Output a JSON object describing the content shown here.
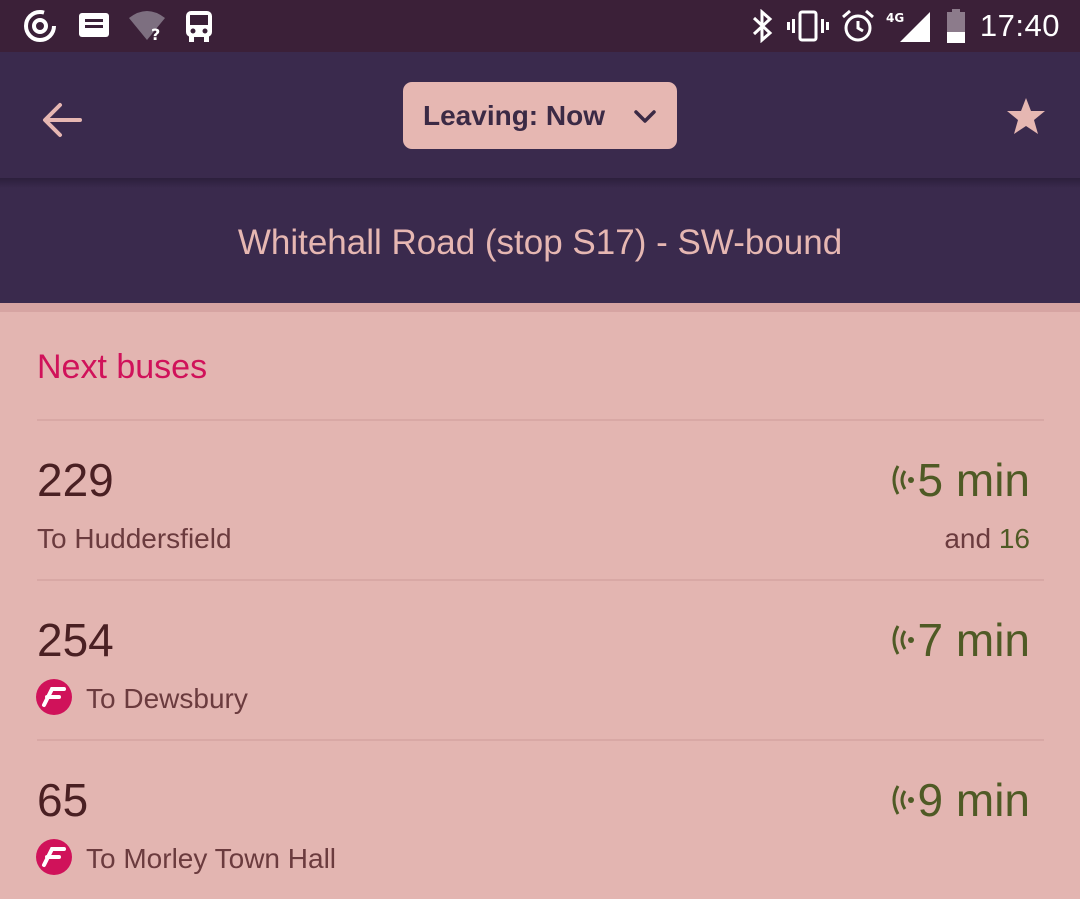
{
  "status_bar": {
    "time": "17:40",
    "network_label": "4G",
    "left_icons": [
      "signal-app-icon",
      "message-icon",
      "wifi-unknown-icon",
      "bus-app-icon"
    ],
    "right_icons": [
      "bluetooth-icon",
      "vibrate-icon",
      "alarm-icon",
      "cell-signal-icon",
      "battery-icon"
    ]
  },
  "toolbar": {
    "leaving_label": "Leaving: Now"
  },
  "stop": {
    "title": "Whitehall Road (stop S17) - SW-bound"
  },
  "section": {
    "title": "Next buses"
  },
  "departures": [
    {
      "route": "229",
      "destination": "To Huddersfield",
      "eta": "5 min",
      "and_label": "and",
      "next": "16",
      "has_operator_logo": false
    },
    {
      "route": "254",
      "destination": "To Dewsbury",
      "eta": "7 min",
      "has_operator_logo": true
    },
    {
      "route": "65",
      "destination": "To Morley Town Hall",
      "eta": "9 min",
      "has_operator_logo": true
    }
  ],
  "colors": {
    "status_bar": "#3b2038",
    "app_bar": "#3a2a4d",
    "background": "#e3b5b1",
    "accent": "#d0125a",
    "eta": "#4f5a25"
  }
}
